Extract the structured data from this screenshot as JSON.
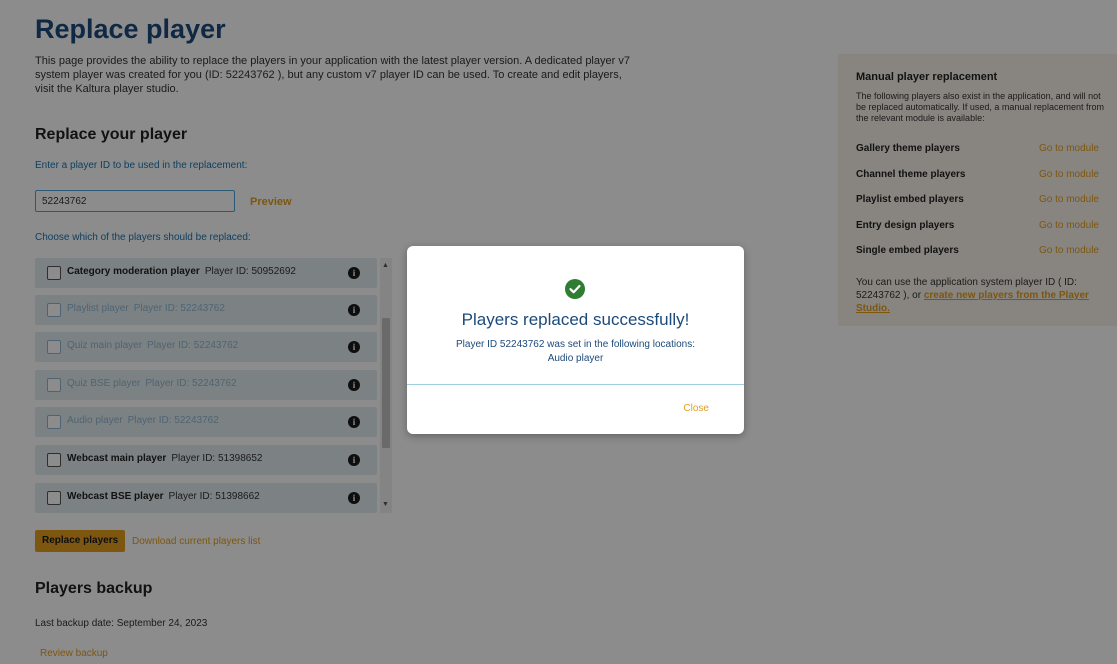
{
  "page": {
    "title": "Replace player",
    "description": "This page provides the ability to replace the players in your application with the latest player version. A dedicated player v7 system player was created for you (ID: 52243762 ), but any custom v7 player ID can be used. To create and edit players, visit the Kaltura player studio."
  },
  "replace": {
    "heading": "Replace your player",
    "input_label": "Enter a player ID to be used in the replacement:",
    "input_value": "52243762",
    "preview_label": "Preview",
    "choose_label": "Choose which of the players should be replaced:",
    "players": [
      {
        "name": "Category moderation player",
        "pid": "Player ID: 50952692",
        "disabled": false
      },
      {
        "name": "Playlist player",
        "pid": "Player ID: 52243762",
        "disabled": true
      },
      {
        "name": "Quiz main player",
        "pid": "Player ID: 52243762",
        "disabled": true
      },
      {
        "name": "Quiz BSE player",
        "pid": "Player ID: 52243762",
        "disabled": true
      },
      {
        "name": "Audio player",
        "pid": "Player ID: 52243762",
        "disabled": true
      },
      {
        "name": "Webcast main player",
        "pid": "Player ID: 51398652",
        "disabled": false
      },
      {
        "name": "Webcast BSE player",
        "pid": "Player ID: 51398662",
        "disabled": false
      }
    ],
    "info_glyph": "i",
    "replace_button": "Replace players",
    "download_link": "Download current players list"
  },
  "backup": {
    "heading": "Players backup",
    "last_date": "Last backup date: September 24, 2023",
    "review_link": "Review backup"
  },
  "sidepanel": {
    "title": "Manual player replacement",
    "description": "The following players also exist in the application, and will not be replaced automatically. If used, a manual replacement from the relevant module is available:",
    "rows": [
      {
        "label": "Gallery theme players",
        "link": "Go to module"
      },
      {
        "label": "Channel theme players",
        "link": "Go to module"
      },
      {
        "label": "Playlist embed players",
        "link": "Go to module"
      },
      {
        "label": "Entry design players",
        "link": "Go to module"
      },
      {
        "label": "Single embed players",
        "link": "Go to module"
      }
    ],
    "note_prefix": "You can use the application system player ID ( ID: 52243762 ), or ",
    "note_link": "create new players from the Player Studio."
  },
  "modal": {
    "title": "Players replaced successfully!",
    "message_line1": "Player ID 52243762 was set in the following locations:",
    "message_line2": "Audio player",
    "close_label": "Close"
  },
  "colors": {
    "accent": "#e39d1e",
    "title_blue": "#1c4a7a",
    "link_blue": "#1b76b0",
    "success_green": "#2e7d32"
  }
}
